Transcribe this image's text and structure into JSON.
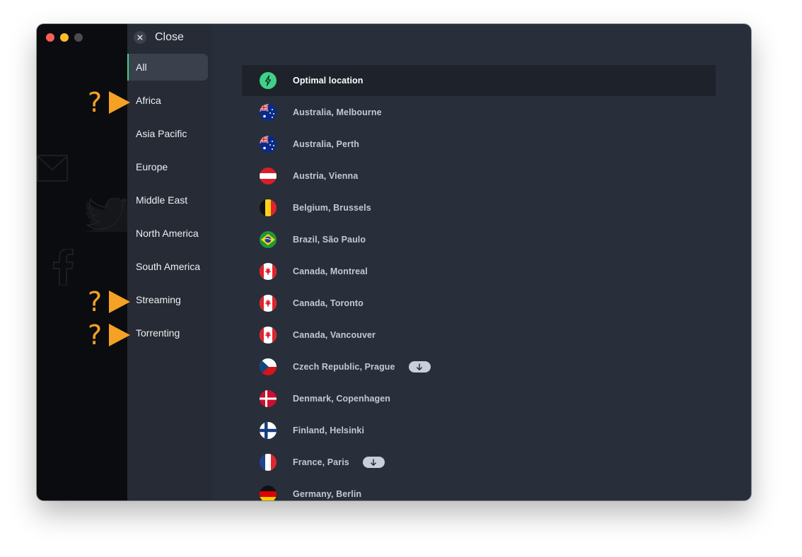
{
  "window": {
    "close_label": "Close"
  },
  "categories": [
    {
      "label": "All",
      "active": true
    },
    {
      "label": "Africa"
    },
    {
      "label": "Asia Pacific"
    },
    {
      "label": "Europe"
    },
    {
      "label": "Middle East"
    },
    {
      "label": "North America"
    },
    {
      "label": "South America"
    },
    {
      "label": "Streaming"
    },
    {
      "label": "Torrenting"
    }
  ],
  "locations": [
    {
      "label": "Optimal location",
      "icon": "bolt-icon",
      "active": true
    },
    {
      "label": "Australia, Melbourne",
      "flag": "australia-flag-icon"
    },
    {
      "label": "Australia, Perth",
      "flag": "australia-flag-icon"
    },
    {
      "label": "Austria, Vienna",
      "flag": "austria-flag-icon"
    },
    {
      "label": "Belgium, Brussels",
      "flag": "belgium-flag-icon"
    },
    {
      "label": "Brazil, São Paulo",
      "flag": "brazil-flag-icon"
    },
    {
      "label": "Canada, Montreal",
      "flag": "canada-flag-icon"
    },
    {
      "label": "Canada, Toronto",
      "flag": "canada-flag-icon"
    },
    {
      "label": "Canada, Vancouver",
      "flag": "canada-flag-icon"
    },
    {
      "label": "Czech Republic, Prague",
      "flag": "czech-flag-icon",
      "badge": "download-arrow-icon"
    },
    {
      "label": "Denmark, Copenhagen",
      "flag": "denmark-flag-icon"
    },
    {
      "label": "Finland, Helsinki",
      "flag": "finland-flag-icon"
    },
    {
      "label": "France, Paris",
      "flag": "france-flag-icon",
      "badge": "download-arrow-icon"
    },
    {
      "label": "Germany, Berlin",
      "flag": "germany-flag-icon"
    }
  ],
  "annotations": {
    "symbol": "?",
    "color": "#f4a125",
    "targets": [
      "Africa",
      "Streaming",
      "Torrenting"
    ]
  },
  "colors": {
    "accent": "#3fd18a",
    "background": "#282e3a",
    "sidebar": "#262b35",
    "annotation": "#f4a125"
  }
}
